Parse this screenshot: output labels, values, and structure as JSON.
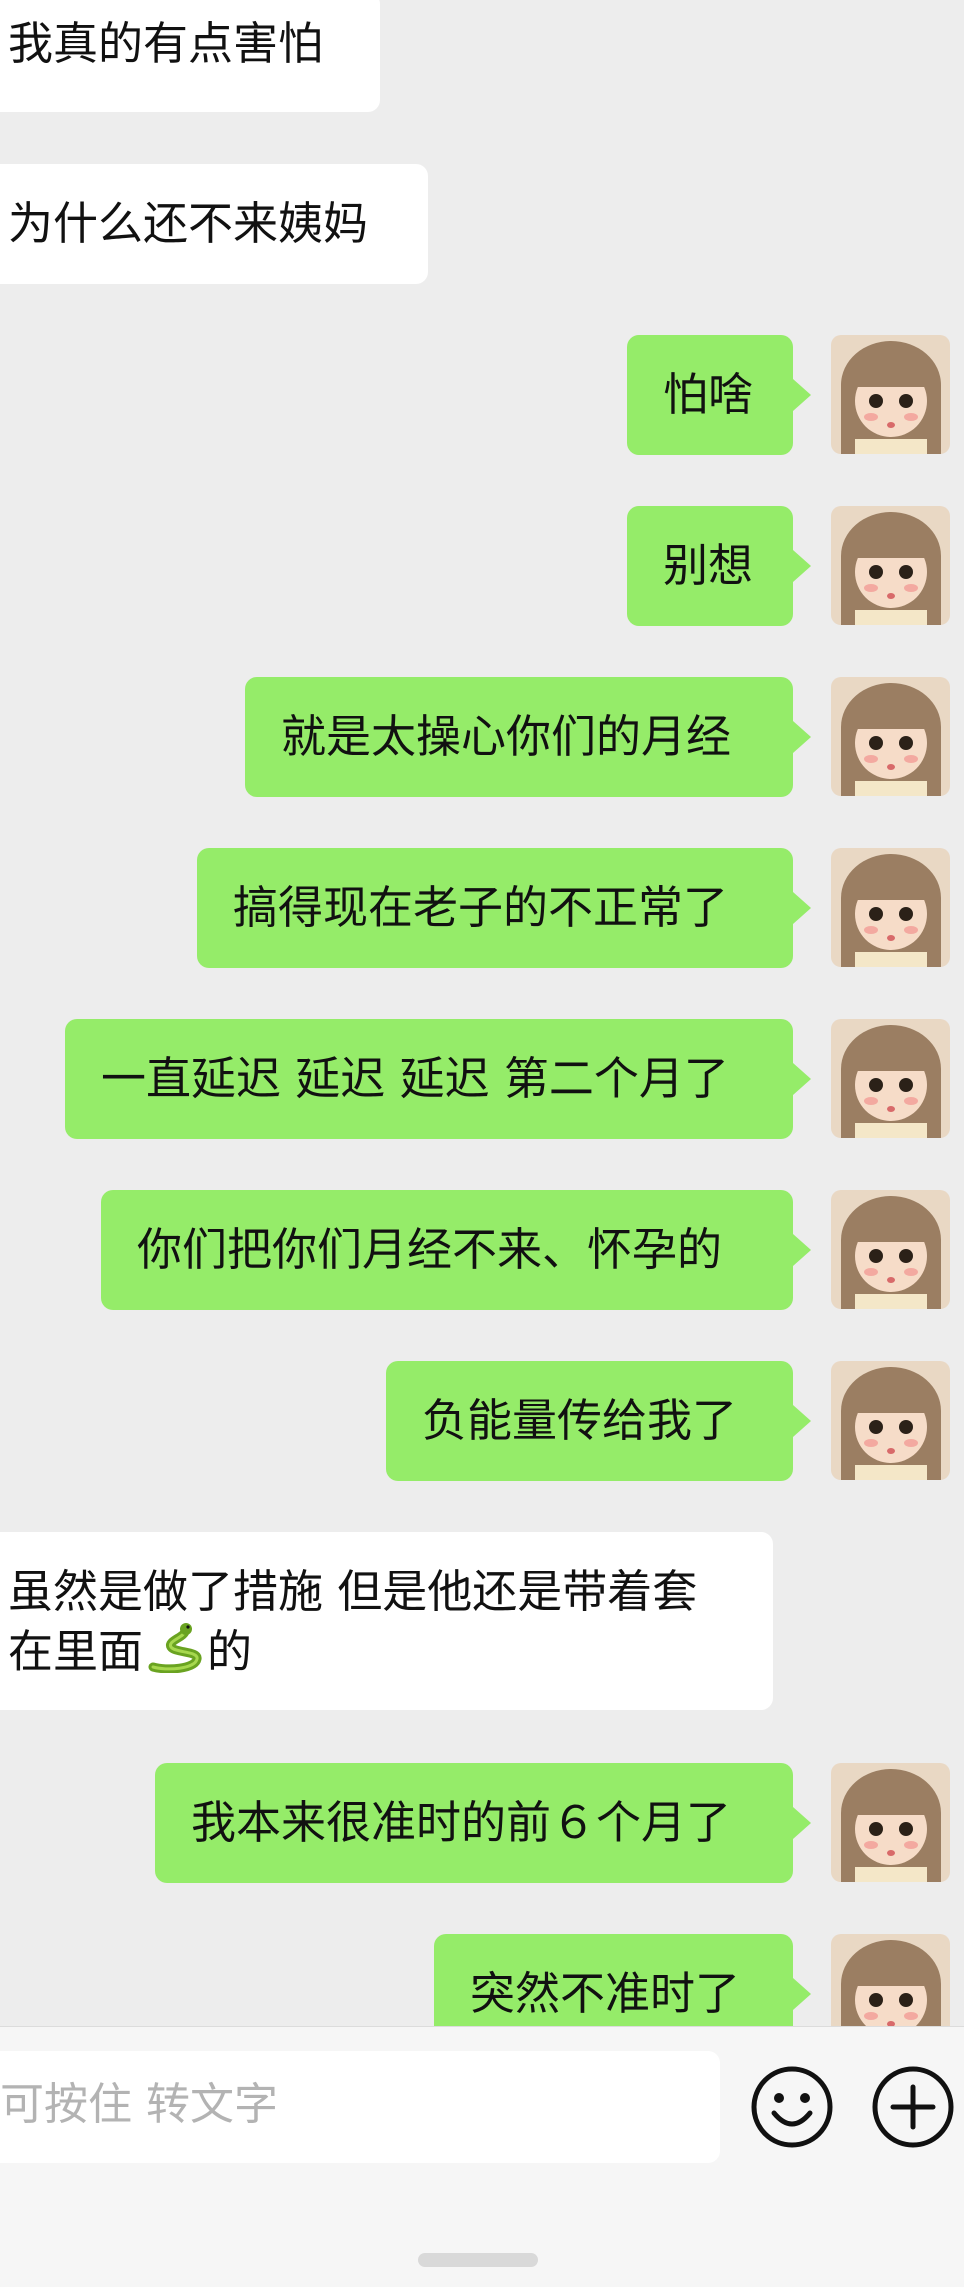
{
  "messages": [
    {
      "side": "in",
      "text": "我真的有点害怕"
    },
    {
      "side": "in",
      "text": "为什么还不来姨妈"
    },
    {
      "side": "out",
      "text": "怕啥"
    },
    {
      "side": "out",
      "text": "别想"
    },
    {
      "side": "out",
      "text": "就是太操心你们的月经"
    },
    {
      "side": "out",
      "text": "搞得现在老子的不正常了"
    },
    {
      "side": "out",
      "text": "一直延迟 延迟 延迟 第二个月了"
    },
    {
      "side": "out",
      "text": "你们把你们月经不来、怀孕的"
    },
    {
      "side": "out",
      "text": "负能量传给我了"
    },
    {
      "side": "in",
      "line1": "虽然是做了措施 但是他还是带着套",
      "line2_pre": "在里面",
      "line2_post": "的",
      "emoji": "snake-emoji"
    },
    {
      "side": "out",
      "text": "我本来很准时的前６个月了"
    },
    {
      "side": "out",
      "text": "突然不准时了"
    }
  ],
  "input_bar": {
    "voice_hint": "可按住 转文字",
    "emoji_icon": "smiley-face-icon",
    "plus_icon": "plus-circle-icon"
  },
  "colors": {
    "background": "#ededed",
    "incoming_bubble": "#ffffff",
    "outgoing_bubble": "#95ec69"
  }
}
